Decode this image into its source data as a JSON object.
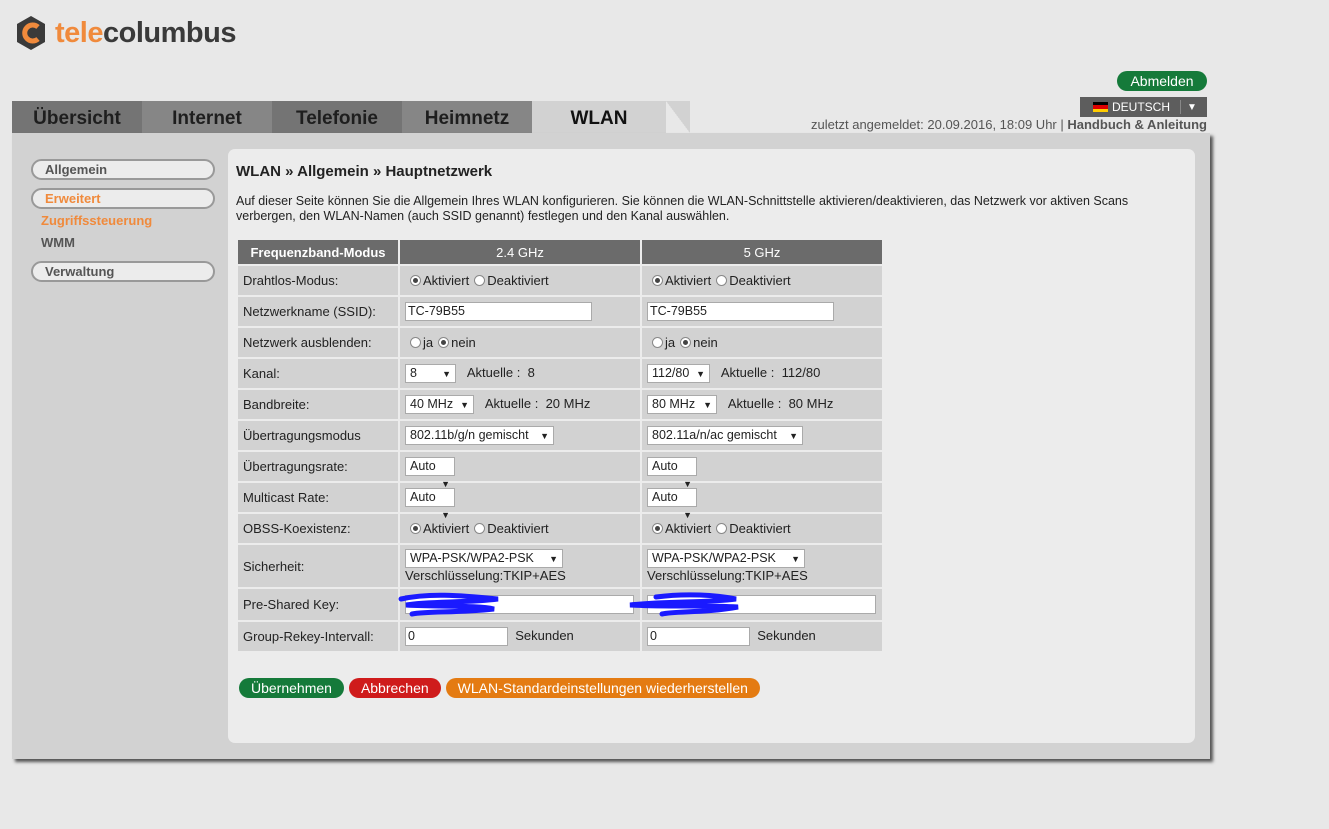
{
  "logo": {
    "part1": "tele",
    "part2": "columbus"
  },
  "header": {
    "logout_label": "Abmelden",
    "language": "DEUTSCH",
    "last_login": "zuletzt angemeldet: 20.09.2016, 18:09 Uhr |",
    "manual_link": "Handbuch & Anleitung"
  },
  "tabs": [
    {
      "label": "Übersicht"
    },
    {
      "label": "Internet"
    },
    {
      "label": "Telefonie"
    },
    {
      "label": "Heimnetz"
    },
    {
      "label": "WLAN"
    }
  ],
  "sidebar": {
    "allgemein": "Allgemein",
    "erweitert": "Erweitert",
    "zugriff": "Zugriffssteuerung",
    "wmm": "WMM",
    "verwaltung": "Verwaltung"
  },
  "breadcrumb": "WLAN » Allgemein » Hauptnetzwerk",
  "description": "Auf dieser Seite können Sie die Allgemein Ihres WLAN konfigurieren. Sie können die WLAN-Schnittstelle aktivieren/deaktivieren, das Netzwerk vor aktiven Scans verbergen, den WLAN-Namen (auch SSID genannt) festlegen und den Kanal auswählen.",
  "table": {
    "headers": [
      "Frequenzband-Modus",
      "2.4 GHz",
      "5 GHz"
    ],
    "labels": {
      "mode": "Drahtlos-Modus:",
      "ssid": "Netzwerkname (SSID):",
      "hide": "Netzwerk ausblenden:",
      "channel": "Kanal:",
      "bandwidth": "Bandbreite:",
      "txmode": "Übertragungsmodus",
      "txrate": "Übertragungsrate:",
      "mcast": "Multicast Rate:",
      "obss": "OBSS-Koexistenz:",
      "security": "Sicherheit:",
      "psk": "Pre-Shared Key:",
      "rekey": "Group-Rekey-Intervall:"
    },
    "words": {
      "activated": "Aktiviert",
      "deactivated": "Deaktiviert",
      "yes": "ja",
      "no": "nein",
      "current": "Aktuelle :",
      "seconds": "Sekunden"
    },
    "band24": {
      "ssid": "TC-79B55",
      "channel": "8",
      "channel_current": "8",
      "bandwidth": "40 MHz",
      "bandwidth_current": "20 MHz",
      "txmode": "802.11b/g/n gemischt",
      "txrate": "Auto",
      "mcast": "Auto",
      "security": "WPA-PSK/WPA2-PSK",
      "encryption": "Verschlüsselung:TKIP+AES",
      "rekey": "0"
    },
    "band5": {
      "ssid": "TC-79B55",
      "channel": "112/80",
      "channel_current": "112/80",
      "bandwidth": "80 MHz",
      "bandwidth_current": "80 MHz",
      "txmode": "802.11a/n/ac gemischt",
      "txrate": "Auto",
      "mcast": "Auto",
      "security": "WPA-PSK/WPA2-PSK",
      "encryption": "Verschlüsselung:TKIP+AES",
      "rekey": "0"
    }
  },
  "buttons": {
    "apply": "Übernehmen",
    "cancel": "Abbrechen",
    "reset": "WLAN-Standardeinstellungen wiederherstellen"
  },
  "colors": {
    "accent_orange": "#f08a3c",
    "green": "#157a3a",
    "red": "#cf1b1b",
    "orange_button": "#e47b12",
    "redaction_blue": "#1a1aff"
  }
}
